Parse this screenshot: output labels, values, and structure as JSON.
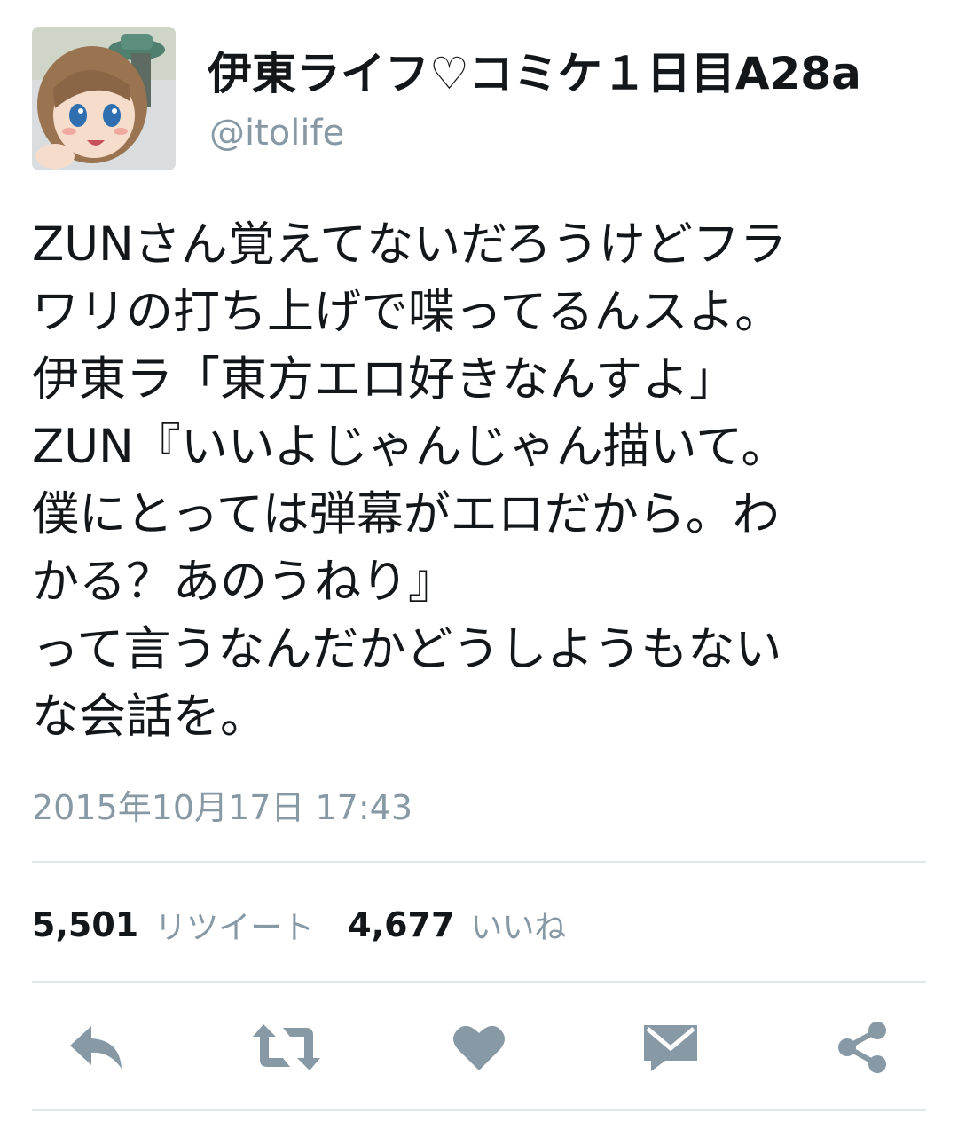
{
  "user": {
    "display_name": "伊東ライフ♡コミケ１日目A28a",
    "handle": "@itolife"
  },
  "tweet": {
    "lines": [
      "ZUNさん覚えてないだろうけどフラ",
      "ワリの打ち上げで喋ってるんスよ。",
      "伊東ラ「東方エロ好きなんすよ」",
      "ZUN『いいよじゃんじゃん描いて。",
      "僕にとっては弾幕がエロだから。わ",
      "かる？あのうねり』",
      "って言うなんだかどうしようもない",
      "な会話を。"
    ],
    "timestamp": "2015年10月17日 17:43"
  },
  "stats": {
    "retweet_count": "5,501",
    "retweet_label": "リツイート",
    "like_count": "4,677",
    "like_label": "いいね"
  },
  "actions": {
    "icons": [
      "reply-icon",
      "retweet-icon",
      "like-icon",
      "message-icon",
      "share-icon"
    ]
  },
  "colors": {
    "text": "#14171a",
    "secondary": "#8899a6",
    "icon": "#8899a6",
    "divider": "#e1e8ed"
  }
}
